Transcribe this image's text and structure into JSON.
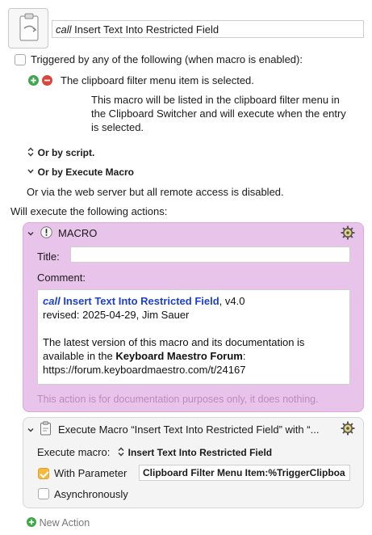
{
  "header": {
    "call_prefix": "call",
    "macro_name": "Insert Text Into Restricted Field"
  },
  "trigger": {
    "label": "Triggered by any of the following (when macro is enabled):",
    "item_label": "The clipboard filter menu item is selected.",
    "description_lines": [
      "This macro will be listed in the clipboard filter menu in",
      "the Clipboard Switcher and will execute when the entry",
      "is selected."
    ],
    "or_by_script": "Or by script.",
    "or_by_execute_macro": "Or by Execute Macro",
    "web_server_note": "Or via the web server but all remote access is disabled."
  },
  "actions_heading": "Will execute the following actions:",
  "macro_action": {
    "title": "MACRO",
    "title_label": "Title:",
    "title_value": "",
    "comment_label": "Comment:",
    "comment": {
      "call_word": "call",
      "name": "Insert Text Into Restricted Field",
      "version": ", v4.0",
      "revised": "revised: 2025-04-29, Jim Sauer",
      "para_start": "The latest version of this macro and its documentation is",
      "para_mid": "available in the ",
      "forum_name": "Keyboard Maestro Forum",
      "para_end": ":",
      "url": "https://forum.keyboardmaestro.com/t/24167"
    },
    "footer_note": "This action is for documentation purposes only, it does nothing.",
    "color": "#e8c3ea"
  },
  "execute_action": {
    "title": "Execute Macro “Insert Text Into Restricted Field” with “...",
    "execute_label": "Execute macro:",
    "execute_value": "Insert Text Into Restricted Field",
    "with_parameter_label": "With Parameter",
    "with_parameter_checked": true,
    "parameter_value": "Clipboard Filter Menu Item:%TriggerClipboa",
    "asynchronously_label": "Asynchronously",
    "asynchronously_checked": false
  },
  "new_action_label": "New Action",
  "icons": {
    "macro_icon": "clipboard-icon",
    "gear": "gear-icon",
    "disclosure": "chevron-down-icon",
    "comment_icon": "exclamation-icon",
    "exec_icon": "macro-document-icon"
  }
}
